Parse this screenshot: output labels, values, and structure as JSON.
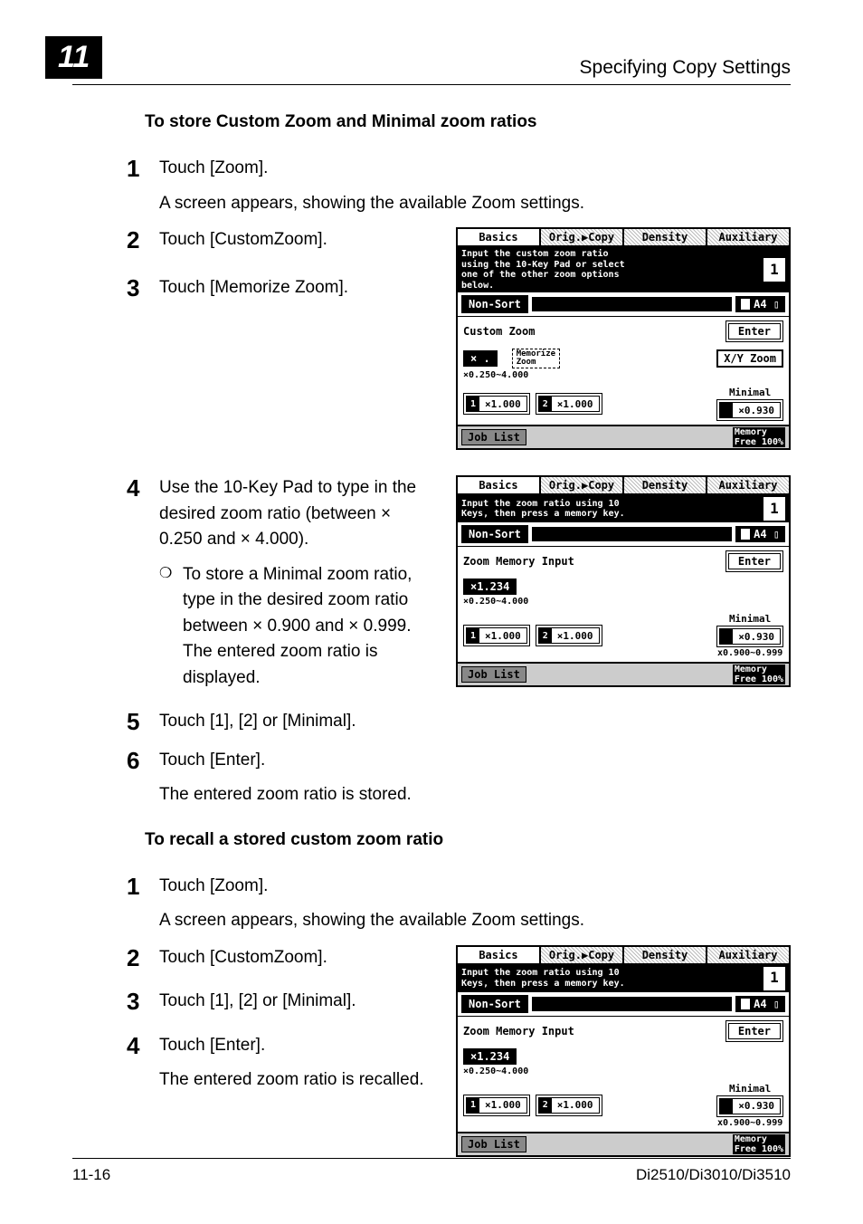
{
  "header": {
    "chapter": "11",
    "title": "Specifying Copy Settings"
  },
  "sectionA": {
    "heading": "To store Custom Zoom and Minimal zoom ratios",
    "steps": [
      {
        "n": "1",
        "text": "Touch [Zoom].",
        "desc": "A screen appears, showing the available Zoom settings."
      },
      {
        "n": "2",
        "text": "Touch [CustomZoom]."
      },
      {
        "n": "3",
        "text": "Touch [Memorize Zoom]."
      },
      {
        "n": "4",
        "text": "Use the 10-Key Pad to type in the desired zoom ratio (between × 0.250 and × 4.000).",
        "sub": "To store a Minimal zoom ratio, type in the desired zoom ratio between × 0.900 and × 0.999. The entered zoom ratio is displayed."
      },
      {
        "n": "5",
        "text": "Touch [1], [2] or [Minimal]."
      },
      {
        "n": "6",
        "text": "Touch [Enter].",
        "desc": "The entered zoom ratio is stored."
      }
    ]
  },
  "sectionB": {
    "heading": "To recall a stored custom zoom ratio",
    "steps": [
      {
        "n": "1",
        "text": "Touch [Zoom].",
        "desc": "A screen appears, showing the available Zoom settings."
      },
      {
        "n": "2",
        "text": "Touch [CustomZoom]."
      },
      {
        "n": "3",
        "text": "Touch [1], [2] or [Minimal]."
      },
      {
        "n": "4",
        "text": "Touch [Enter].",
        "desc": "The entered zoom ratio is recalled."
      }
    ]
  },
  "shot1": {
    "tabs": [
      "Basics",
      "Orig.▶Copy",
      "Density",
      "Auxiliary"
    ],
    "msg": "Input the custom zoom ratio\nusing the 10-Key Pad or select\none of the other zoom options\nbelow.",
    "count": "1",
    "nonsort": "Non-Sort",
    "paper": "A4 ▯",
    "czlabel": "Custom Zoom",
    "enter": "Enter",
    "xdisp": "× .",
    "memorize": "Memorize\nZoom",
    "xyzoom": "X/Y Zoom",
    "range": "×0.250∼4.000",
    "minlabel": "Minimal",
    "b1": "×1.000",
    "b2": "×1.000",
    "bmin": "×0.930",
    "joblist": "Job List",
    "memfree": "Memory\nFree 100%"
  },
  "shot2": {
    "tabs": [
      "Basics",
      "Orig.▶Copy",
      "Density",
      "Auxiliary"
    ],
    "msg": "Input the zoom ratio using 10\nKeys, then press a memory key.",
    "count": "1",
    "nonsort": "Non-Sort",
    "paper": "A4 ▯",
    "czlabel": "Zoom Memory Input",
    "enter": "Enter",
    "xdisp": "×1.234",
    "range": "×0.250∼4.000",
    "minlabel": "Minimal",
    "b1": "×1.000",
    "b2": "×1.000",
    "bmin": "×0.930",
    "minsub": "x0.900∼0.999",
    "joblist": "Job List",
    "memfree": "Memory\nFree 100%"
  },
  "shot3": {
    "tabs": [
      "Basics",
      "Orig.▶Copy",
      "Density",
      "Auxiliary"
    ],
    "msg": "Input the zoom ratio using 10\nKeys, then press a memory key.",
    "count": "1",
    "nonsort": "Non-Sort",
    "paper": "A4 ▯",
    "czlabel": "Zoom Memory Input",
    "enter": "Enter",
    "xdisp": "×1.234",
    "range": "×0.250∼4.000",
    "minlabel": "Minimal",
    "b1": "×1.000",
    "b2": "×1.000",
    "bmin": "×0.930",
    "minsub": "x0.900∼0.999",
    "joblist": "Job List",
    "memfree": "Memory\nFree 100%"
  },
  "footer": {
    "left": "11-16",
    "right": "Di2510/Di3010/Di3510"
  }
}
